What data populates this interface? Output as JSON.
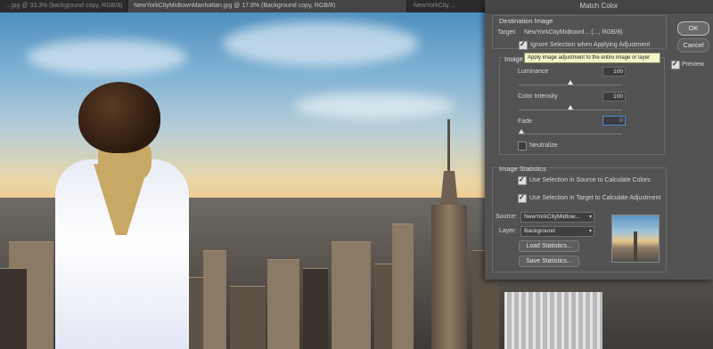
{
  "tabs": [
    {
      "label": "…jpg @ 33.3% (background copy, RGB/8)"
    },
    {
      "label": "NewYorkCityMidtownManhattan.jpg @ 17.8% (Background copy, RGB/8)"
    },
    {
      "label": "NewYorkCity…"
    }
  ],
  "dialog": {
    "title": "Match Color",
    "ok_label": "OK",
    "cancel_label": "Cancel",
    "preview_label": "Preview",
    "preview_checked": true,
    "destination": {
      "header": "Destination Image",
      "target_label": "Target:",
      "target_value": "NewYorkCityMidtownl... (..., RGB/8)",
      "ignore_selection_label": "Ignore Selection when Applying Adjustment",
      "ignore_selection_checked": true
    },
    "tooltip": "Apply image adjustment to the entire image or layer",
    "image_options": {
      "header": "Image",
      "luminance_label": "Luminance",
      "luminance_value": "100",
      "color_intensity_label": "Color Intensity",
      "color_intensity_value": "100",
      "fade_label": "Fade",
      "fade_value": "0",
      "neutralize_label": "Neutralize",
      "neutralize_checked": false
    },
    "statistics": {
      "header": "Image Statistics",
      "use_source_label": "Use Selection in Source to Calculate Colors",
      "use_source_checked": true,
      "use_target_label": "Use Selection in Target to Calculate Adjustment",
      "use_target_checked": true,
      "source_label": "Source:",
      "source_value": "NewYorkCityMidtow...",
      "layer_label": "Layer:",
      "layer_value": "Background",
      "load_label": "Load Statistics...",
      "save_label": "Save Statistics..."
    }
  }
}
